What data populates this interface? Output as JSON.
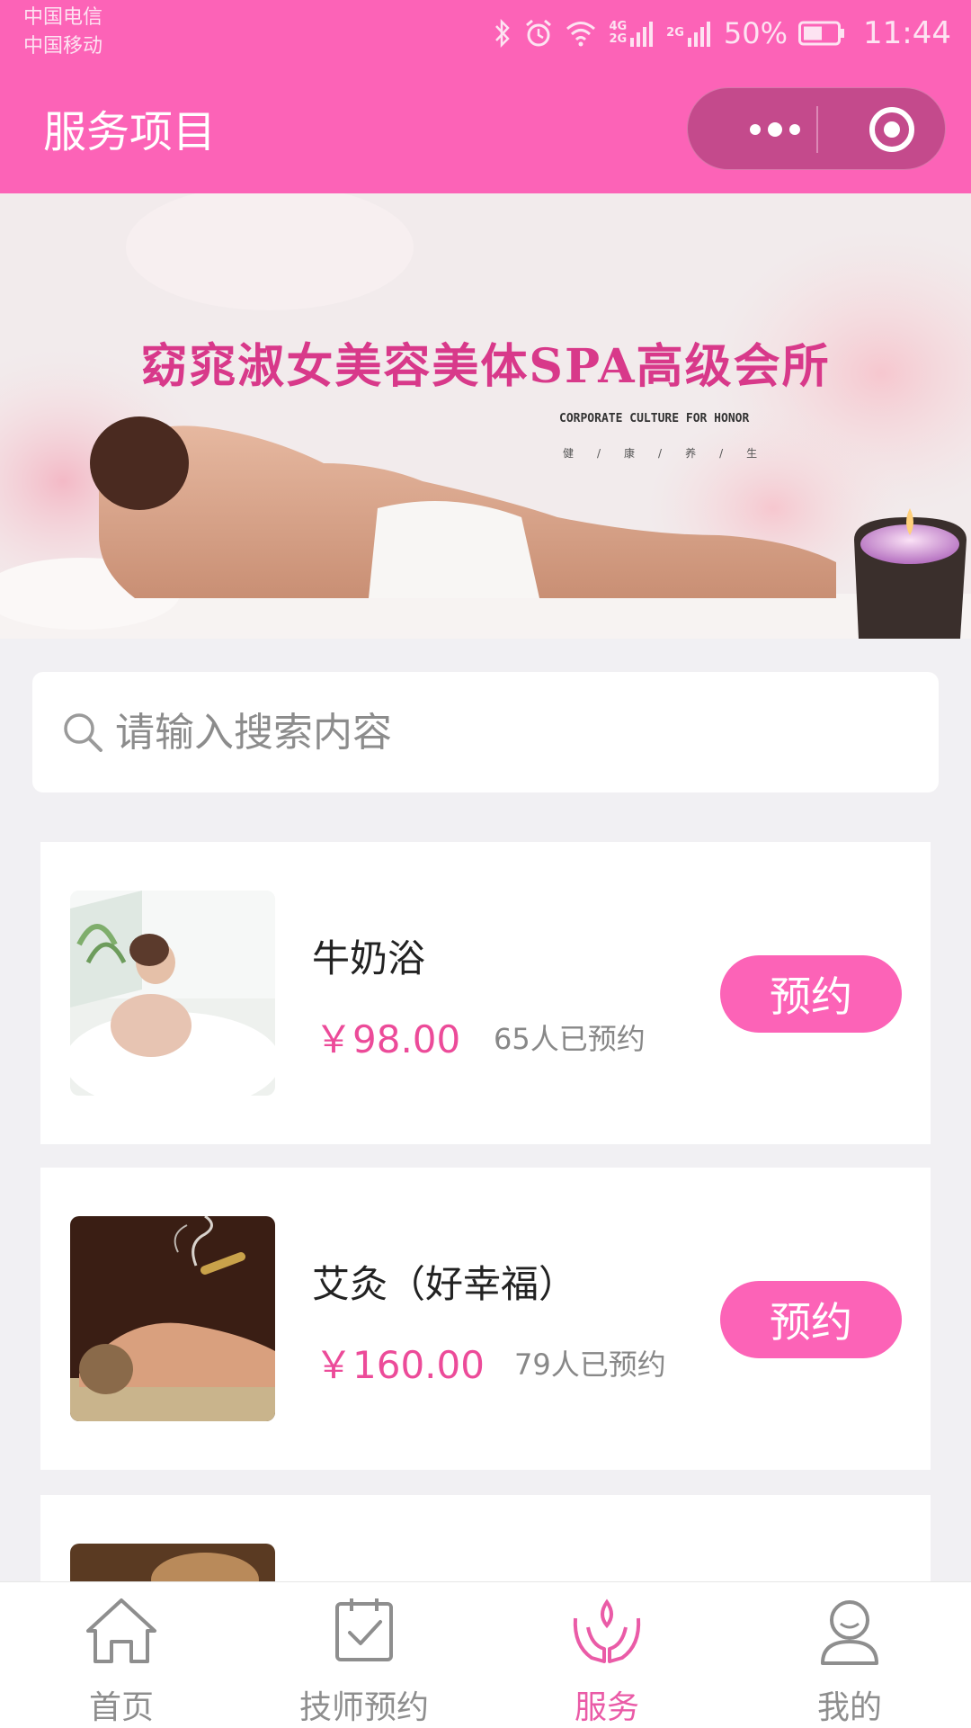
{
  "status_bar": {
    "carrier_1": "中国电信",
    "carrier_2": "中国移动",
    "net_1_top": "4G",
    "net_1_bottom": "2G",
    "net_2": "2G",
    "battery": "50%",
    "time": "11:44"
  },
  "header": {
    "title": "服务项目"
  },
  "banner": {
    "title": "窈窕淑女美容美体SPA高级会所",
    "subtitle": "CORPORATE CULTURE FOR HONOR",
    "tags": "健/康/养/生"
  },
  "search": {
    "placeholder": "请输入搜索内容"
  },
  "services": [
    {
      "name": "牛奶浴",
      "price": "￥98.00",
      "booked": "65人已预约",
      "button": "预约"
    },
    {
      "name": "艾灸（好幸福）",
      "price": "￥160.00",
      "booked": "79人已预约",
      "button": "预约"
    }
  ],
  "tabbar": {
    "items": [
      {
        "label": "首页",
        "icon": "home-icon"
      },
      {
        "label": "技师预约",
        "icon": "calendar-check-icon"
      },
      {
        "label": "服务",
        "icon": "lotus-hands-icon",
        "active": true
      },
      {
        "label": "我的",
        "icon": "user-icon"
      }
    ]
  },
  "colors": {
    "brand": "#fc63b7",
    "price": "#ec4b99",
    "active_tab": "#ea5ba7"
  }
}
